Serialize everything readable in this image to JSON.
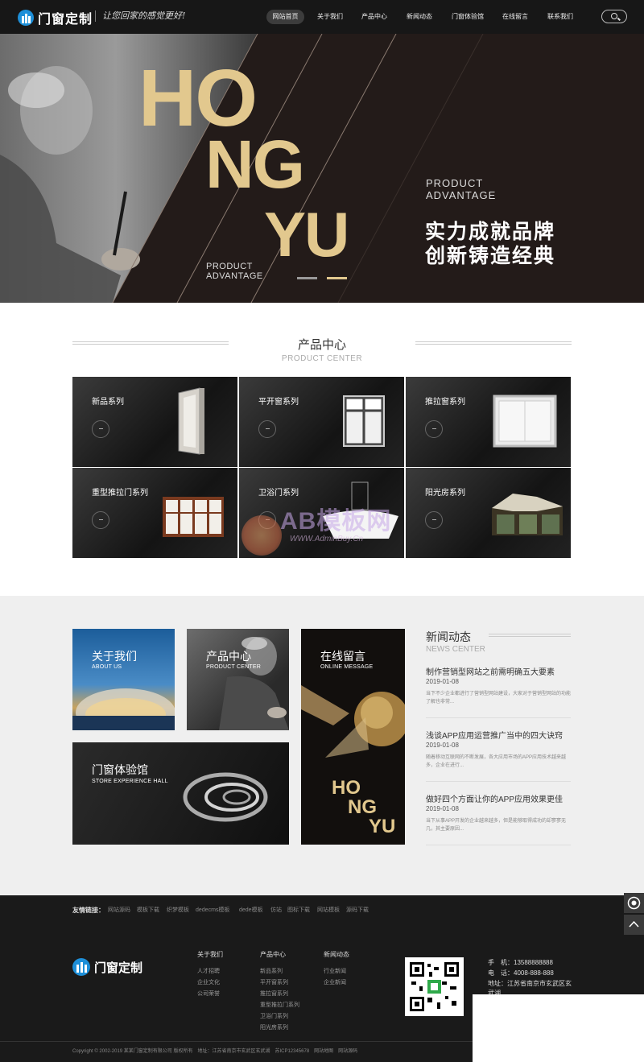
{
  "header": {
    "logo_text": "门窗定制",
    "slogan": "让您回家的感觉更好!",
    "nav": [
      "网站首页",
      "关于我们",
      "产品中心",
      "新闻动态",
      "门窗体验馆",
      "在线留言",
      "联系我们"
    ],
    "active_nav": 0,
    "search_icon": "search-icon"
  },
  "banner": {
    "big_letters": [
      "HO",
      "NG",
      "YU"
    ],
    "left_caption": [
      "PRODUCT",
      "ADVANTAGE"
    ],
    "right_caption": [
      "PRODUCT",
      "ADVANTAGE"
    ],
    "slogan_lines": [
      "实力成就品牌",
      "创新铸造经典"
    ],
    "accent_color": "#e2c88e",
    "slide_count": 2,
    "active_slide": 1
  },
  "product_center": {
    "title_cn": "产品中心",
    "title_en": "PRODUCT CENTER",
    "items": [
      "新品系列",
      "平开窗系列",
      "推拉窗系列",
      "重型推拉门系列",
      "卫浴门系列",
      "阳光房系列"
    ]
  },
  "watermark": {
    "text": "AB模板网",
    "sub": "WWW.AdminBuy.Cn"
  },
  "tiles": {
    "about": {
      "cn": "关于我们",
      "en": "ABOUT US"
    },
    "product": {
      "cn": "产品中心",
      "en": "PRODUCT CENTER"
    },
    "message": {
      "cn": "在线留言",
      "en": "ONLINE MESSAGE",
      "letters": [
        "HO",
        "NG",
        "YU"
      ]
    },
    "store": {
      "cn": "门窗体验馆",
      "en": "STORE EXPERIENCE HALL"
    }
  },
  "news": {
    "title_cn": "新闻动态",
    "title_en": "NEWS CENTER",
    "items": [
      {
        "title": "制作营销型网站之前需明确五大要素",
        "date": "2019-01-08",
        "summary": "当下不少企业都进行了营销型网站建设，大家对于营销型网站的功能了解也非常..."
      },
      {
        "title": "浅谈APP应用运营推广当中的四大诀窍",
        "date": "2019-01-08",
        "summary": "随着移动互联网的不断发展，各大应用市场的APP应用技术越来越多，企业在进行..."
      },
      {
        "title": "做好四个方面让你的APP应用效果更佳",
        "date": "2019-01-08",
        "summary": "当下从事APP开发的企业越来越多，但是能够取得成功的却寥寥无几，其主要原因..."
      }
    ]
  },
  "footer": {
    "links_label": "友情链接：",
    "links": [
      "网站源码",
      "模板下载",
      "织梦模板",
      "dedecms模板",
      "dede模板",
      "仿站",
      "图标下载",
      "网站模板",
      "源码下载"
    ],
    "logo_text": "门窗定制",
    "columns": [
      {
        "title": "关于我们",
        "items": [
          "人才招聘",
          "企业文化",
          "公司荣誉"
        ]
      },
      {
        "title": "产品中心",
        "items": [
          "新品系列",
          "平开窗系列",
          "推拉窗系列",
          "重型推拉门系列",
          "卫浴门系列",
          "阳光房系列"
        ]
      },
      {
        "title": "新闻动态",
        "items": [
          "行业新闻",
          "企业新闻"
        ]
      }
    ],
    "contact": [
      "手　机：13588888888",
      "电　话：4008-888-888",
      "地址：江苏省南京市玄武区玄武湖"
    ],
    "copyright": "Copyright © 2002-2019 某某门窗定制有限公司 版权所有　地址：江苏省南京市玄武区玄武湖　苏ICP12345678　网站地图　网站源码"
  },
  "side_tools": [
    "qq-icon",
    "back-to-top-icon"
  ]
}
